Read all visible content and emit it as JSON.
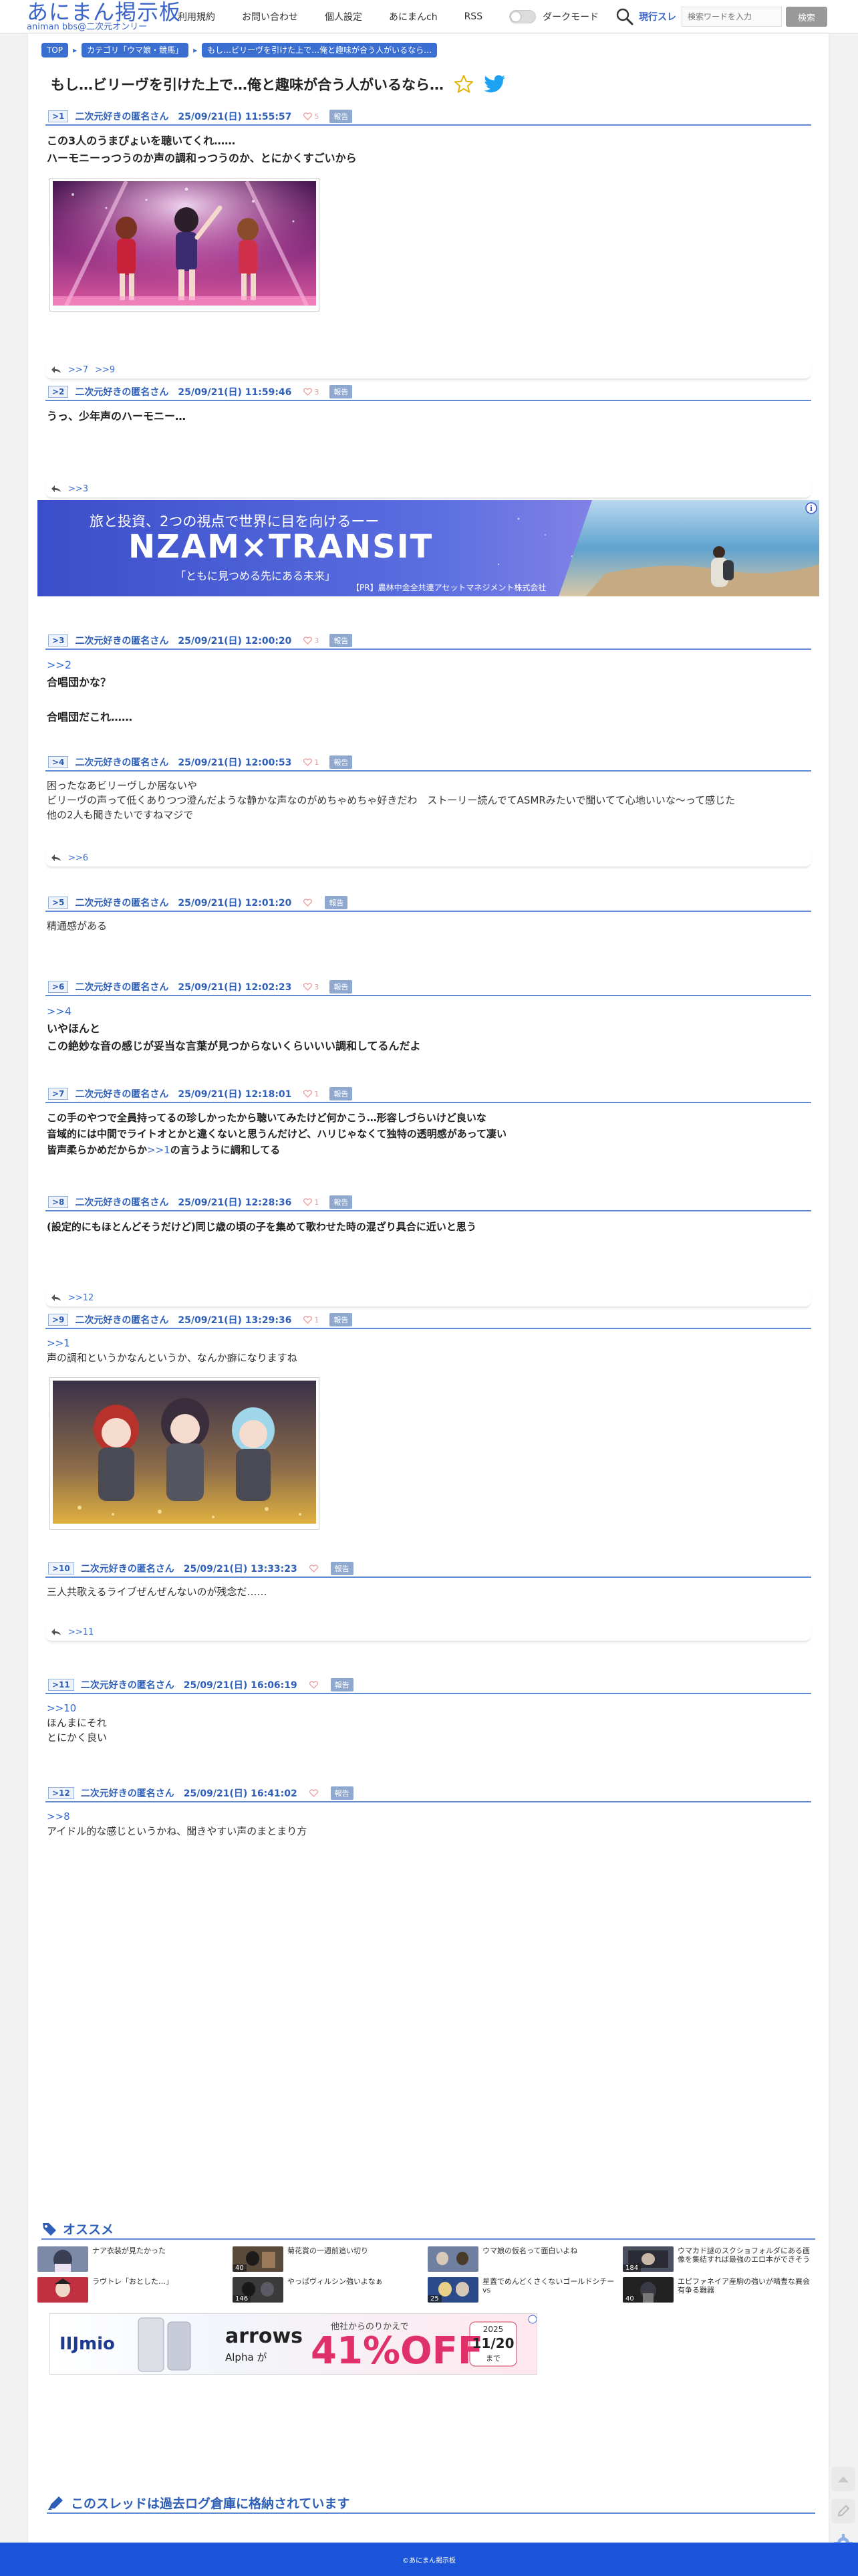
{
  "header": {
    "logo_main": "あにまん掲示板",
    "logo_sub": "animan bbs@二次元オンリー",
    "nav": [
      "利用規約",
      "お問い合わせ",
      "個人設定",
      "あにまんch",
      "RSS"
    ],
    "dark_mode_label": "ダークモード",
    "search_scope": "現行スレ",
    "search_placeholder": "検索ワードを入力",
    "search_button": "検索"
  },
  "breadcrumb": [
    "TOP",
    "カテゴリ「ウマ娘・競馬」",
    "もし…ビリーヴを引けた上で…俺と趣味が合う人がいるなら…"
  ],
  "thread_title": "もし…ビリーヴを引けた上で…俺と趣味が合う人がいるなら…",
  "report_label": "報告",
  "posts": [
    {
      "num": ">1",
      "name": "二次元好きの匿名さん",
      "date": "25/09/21(日) 11:55:57",
      "likes": "5",
      "lines": [
        "この3人のうまぴょいを聴いてくれ……",
        "ハーモニーっつうのか声の調和っつうのか、とにかくすごいから"
      ],
      "replies": [
        ">>7",
        ">>9"
      ]
    },
    {
      "num": ">2",
      "name": "二次元好きの匿名さん",
      "date": "25/09/21(日) 11:59:46",
      "likes": "3",
      "lines": [
        "うっ、少年声のハーモニー…"
      ],
      "replies": [
        ">>3"
      ]
    },
    {
      "num": ">3",
      "name": "二次元好きの匿名さん",
      "date": "25/09/21(日) 12:00:20",
      "likes": "3",
      "anchor": ">>2",
      "lines": [
        "合唱団かな？",
        "",
        "合唱団だこれ……"
      ],
      "replies": []
    },
    {
      "num": ">4",
      "name": "二次元好きの匿名さん",
      "date": "25/09/21(日) 12:00:53",
      "likes": "1",
      "lines": [
        "困ったなあビリーヴしか居ないや",
        "ビリーヴの声って低くありつつ澄んだような静かな声なのがめちゃめちゃ好きだわ　ストーリー読んでてASMRみたいで聞いてて心地いいな〜って感じた",
        "他の2人も聞きたいですねマジで"
      ],
      "replies": [
        ">>6"
      ]
    },
    {
      "num": ">5",
      "name": "二次元好きの匿名さん",
      "date": "25/09/21(日) 12:01:20",
      "likes": "",
      "lines": [
        "精通感がある"
      ],
      "replies": []
    },
    {
      "num": ">6",
      "name": "二次元好きの匿名さん",
      "date": "25/09/21(日) 12:02:23",
      "likes": "3",
      "anchor": ">>4",
      "lines": [
        "いやほんと",
        "この絶妙な音の感じが妥当な言葉が見つからないくらいいい調和してるんだよ"
      ],
      "replies": []
    },
    {
      "num": ">7",
      "name": "二次元好きの匿名さん",
      "date": "25/09/21(日) 12:18:01",
      "likes": "1",
      "lines": [
        "この手のやつで全員持ってるの珍しかったから聴いてみたけど何かこう…形容しづらいけど良いな",
        "音域的には中間でライトオとかと違くないと思うんだけど、ハリじゃなくて独特の透明感があって凄い"
      ],
      "mixed": {
        "pre": "皆声柔らかめだからか",
        "anc": ">>1",
        "post": "の言うように調和してる"
      },
      "replies": []
    },
    {
      "num": ">8",
      "name": "二次元好きの匿名さん",
      "date": "25/09/21(日) 12:28:36",
      "likes": "1",
      "lines": [
        "(設定的にもほとんどそうだけど)同じ歳の頃の子を集めて歌わせた時の混ざり具合に近いと思う"
      ],
      "replies": [
        ">>12"
      ]
    },
    {
      "num": ">9",
      "name": "二次元好きの匿名さん",
      "date": "25/09/21(日) 13:29:36",
      "likes": "1",
      "anchor": ">>1",
      "lines": [
        "声の調和というかなんというか、なんか癖になりますね"
      ],
      "replies": []
    },
    {
      "num": ">10",
      "name": "二次元好きの匿名さん",
      "date": "25/09/21(日) 13:33:23",
      "likes": "",
      "lines": [
        "三人共歌えるライブぜんぜんないのが残念だ……"
      ],
      "replies": [
        ">>11"
      ]
    },
    {
      "num": ">11",
      "name": "二次元好きの匿名さん",
      "date": "25/09/21(日) 16:06:19",
      "likes": "",
      "anchor": ">>10",
      "lines": [
        "ほんまにそれ",
        "とにかく良い"
      ],
      "replies": []
    },
    {
      "num": ">12",
      "name": "二次元好きの匿名さん",
      "date": "25/09/21(日) 16:41:02",
      "likes": "",
      "anchor": ">>8",
      "lines": [
        "アイドル的な感じというかね、聞きやすい声のまとまり方"
      ],
      "replies": []
    }
  ],
  "ad_banner": {
    "top_text": "旅と投資、2つの視点で世界に目を向けるーー",
    "brand": "NZAM×TRANSIT",
    "tagline": "「ともに見つめる先にある未来」",
    "sponsor": "【PR】農林中金全共連アセットマネジメント株式会社"
  },
  "osusume": {
    "title": "オススメ",
    "items": [
      {
        "title": "ナア衣装が見たかった",
        "count": ""
      },
      {
        "title": "菊花賞の一週前追い切り",
        "count": "40"
      },
      {
        "title": "ウマ娘の仮名って面白いよね",
        "count": ""
      },
      {
        "title": "ウマカド謎のスクショフォルダにある画像を集結すれば最強のエロ本ができそう",
        "count": "184"
      },
      {
        "title": "ラヴトレ「おとした…」",
        "count": ""
      },
      {
        "title": "やっぱヴィルシン強いよなぁ",
        "count": "146"
      },
      {
        "title": "星蓋でめんどくさくないゴールドシチーvs",
        "count": "25"
      },
      {
        "title": "エピファネイア産駒の強いが晴豊な異会有争る難器",
        "count": "40"
      }
    ]
  },
  "ad_bottom": {
    "brand": "IIJmio",
    "product": "arrows",
    "product_sub": "Alpha が",
    "note": "他社からのりかえで",
    "discount": "41%OFF",
    "date_year": "2025",
    "date_day": "11/20",
    "date_suffix": "まで"
  },
  "archive_title": "このスレッドは過去ログ倉庫に格納されています",
  "footer": "©あにまん掲示板",
  "colors": {
    "accent": "#3a6fd1",
    "post_head": "#2e5fb8",
    "footer": "#1b54d8"
  }
}
